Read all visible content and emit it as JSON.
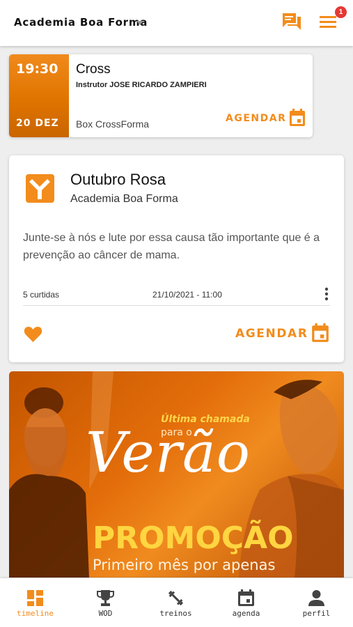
{
  "colors": {
    "accent": "#f28c1c",
    "badge": "#e53935"
  },
  "header": {
    "gym_name": "Academia Boa Forma",
    "notification_count": "1",
    "icons": [
      "caret-down-icon",
      "chat-icon",
      "menu-icon"
    ]
  },
  "class_card": {
    "time": "19:30",
    "date": "20 DEZ",
    "name": "Cross",
    "instructor": "Instrutor JOSE RICARDO ZAMPIERI",
    "room": "Box CrossForma",
    "action": "AGENDAR",
    "action_icon": "calendar-icon"
  },
  "post": {
    "title": "Outubro Rosa",
    "author": "Academia Boa Forma",
    "body": "Junte-se à nós e lute por essa causa tão importante que é a prevenção ao câncer de mama.",
    "likes": "5 curtidas",
    "datetime": "21/10/2021 - 11:00",
    "action": "AGENDAR",
    "icons": [
      "academy-logo-icon",
      "more-vert-icon",
      "heart-icon",
      "calendar-icon"
    ]
  },
  "banner": {
    "line1": "Última chamada",
    "line2": "para o",
    "headline": "Verão",
    "promo": "PROMOÇÃO",
    "subline": "Primeiro mês por apenas"
  },
  "bottom_nav": [
    {
      "label": "timeline",
      "icon": "dashboard-icon",
      "active": true
    },
    {
      "label": "WOD",
      "icon": "trophy-icon",
      "active": false
    },
    {
      "label": "treinos",
      "icon": "dumbbell-icon",
      "active": false
    },
    {
      "label": "agenda",
      "icon": "calendar-icon",
      "active": false
    },
    {
      "label": "perfil",
      "icon": "person-icon",
      "active": false
    }
  ]
}
